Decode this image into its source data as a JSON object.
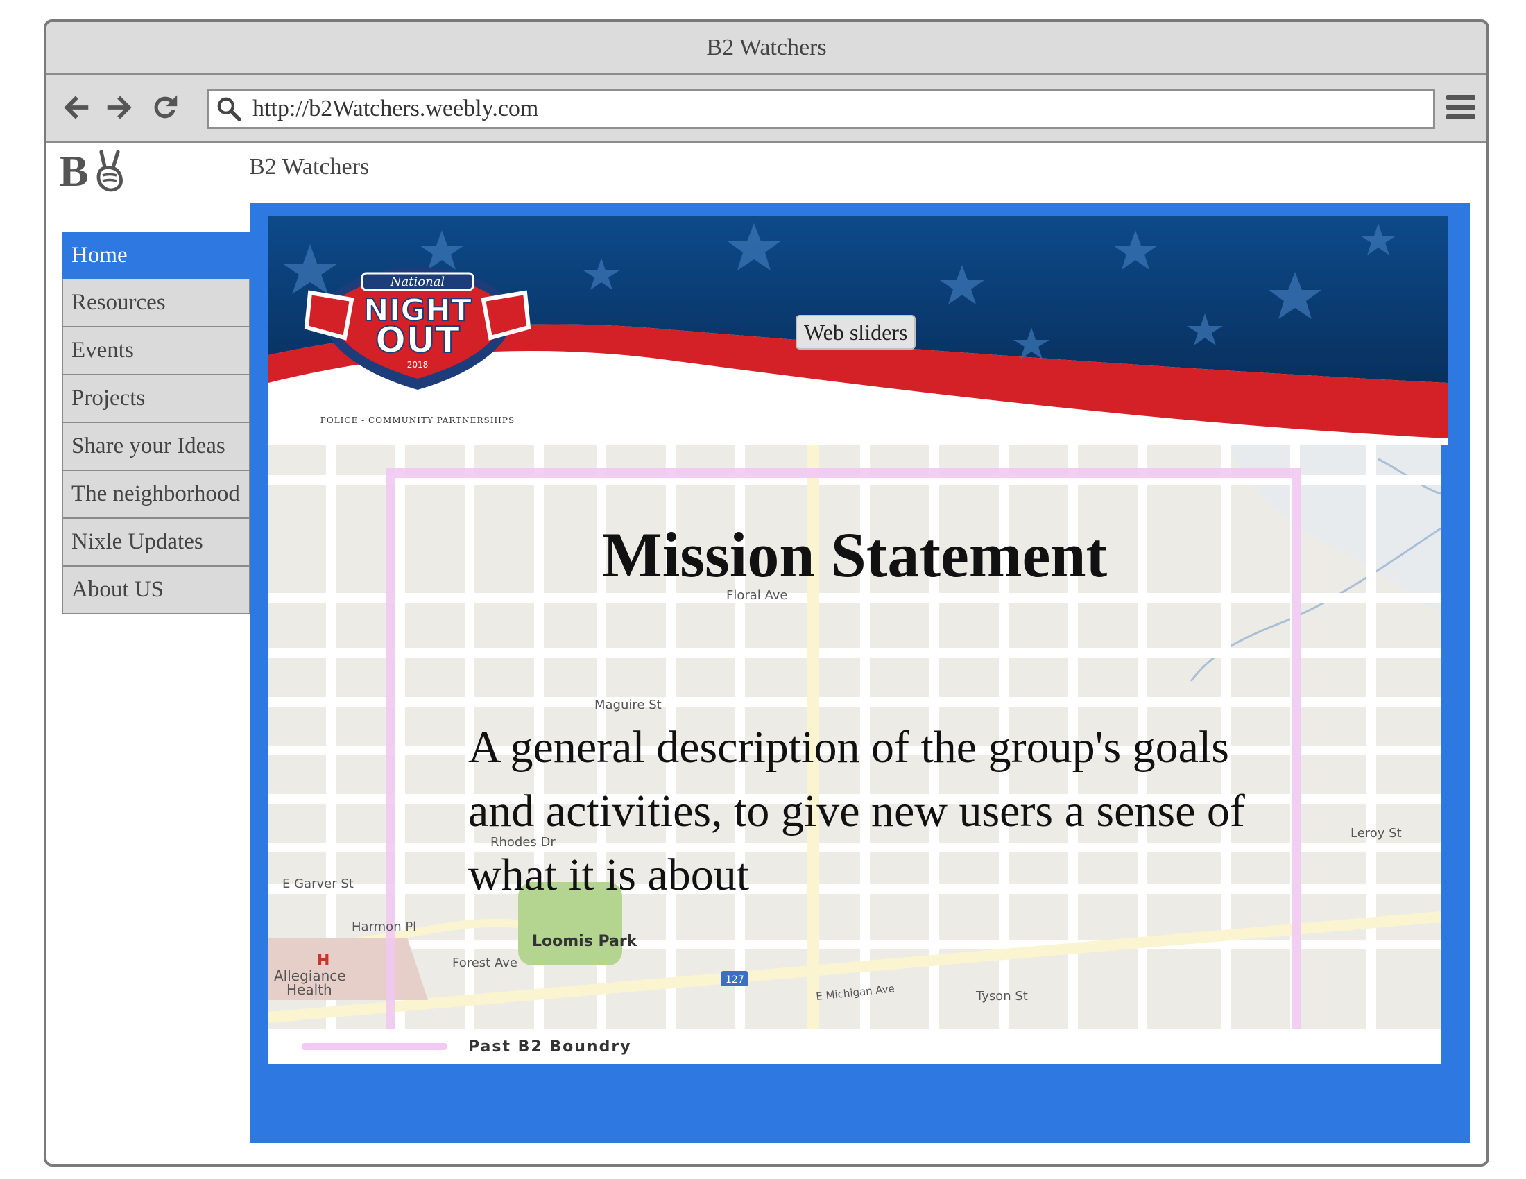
{
  "window": {
    "title": "B2 Watchers"
  },
  "browser": {
    "url": "http://b2Watchers.weebly.com"
  },
  "site": {
    "logo_letter": "B",
    "title": "B2 Watchers"
  },
  "sidebar": {
    "items": [
      {
        "label": "Home",
        "active": true
      },
      {
        "label": "Resources"
      },
      {
        "label": "Events"
      },
      {
        "label": "Projects"
      },
      {
        "label": "Share your Ideas"
      },
      {
        "label": "The neighborhood"
      },
      {
        "label": "Nixle Updates"
      },
      {
        "label": "About US"
      }
    ]
  },
  "slider": {
    "label": "Web sliders",
    "badge": {
      "top": "National",
      "line1": "NIGHT",
      "line2": "OUT",
      "year": "2018",
      "tagline": "POLICE - COMMUNITY PARTNERSHIPS"
    }
  },
  "map": {
    "legend": "Past B2 Boundry",
    "labels": {
      "floral": "Floral Ave",
      "maguire": "Maguire St",
      "rhodes": "Rhodes Dr",
      "garver": "E Garver St",
      "harmon": "Harmon Pl",
      "forest": "Forest Ave",
      "loomis": "Loomis Park",
      "allegiance": "Allegiance",
      "health": "Health",
      "tyson": "Tyson St",
      "michigan": "E Michigan Ave",
      "leroy": "Leroy St",
      "hospital_mark": "H",
      "route": "127"
    }
  },
  "mission": {
    "title": "Mission Statement",
    "text": "A general description of the group's goals and activities, to give new users a sense of what it is about"
  },
  "colors": {
    "accent": "#2d78e1",
    "boundary": "#f1c9f1",
    "banner_red": "#d42027",
    "banner_navy": "#0c3d78"
  }
}
